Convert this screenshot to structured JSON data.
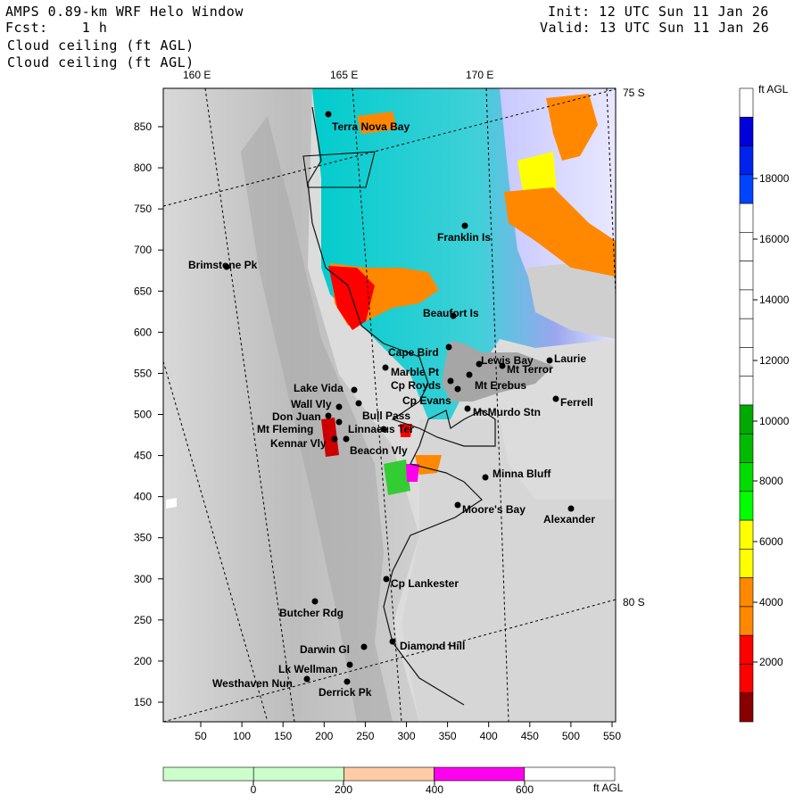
{
  "header": {
    "title": "AMPS 0.89-km WRF Helo Window",
    "fcst": "Fcst:    1 h",
    "field1": "Cloud ceiling (ft AGL)",
    "field2": "Cloud ceiling (ft AGL)",
    "init": "Init: 12 UTC Sun 11 Jan 26",
    "valid": "Valid: 13 UTC Sun 11 Jan 26"
  },
  "axes": {
    "lon_labels": [
      "160 E",
      "165 E",
      "170 E"
    ],
    "lat_labels": [
      "75 S",
      "80 S"
    ],
    "y_ticks": [
      "850",
      "800",
      "750",
      "700",
      "650",
      "600",
      "550",
      "500",
      "450",
      "400",
      "350",
      "300",
      "250",
      "200",
      "150"
    ],
    "x_ticks": [
      "50",
      "100",
      "150",
      "200",
      "250",
      "300",
      "350",
      "400",
      "450",
      "500",
      "550"
    ]
  },
  "colorbar_right": {
    "unit": "ft AGL",
    "labels": [
      "18000",
      "16000",
      "14000",
      "12000",
      "10000",
      "8000",
      "6000",
      "4000",
      "2000"
    ],
    "colors": [
      "#ffffff",
      "#0000dd",
      "#0022ee",
      "#0044ff",
      "#ffffff",
      "#ffffff",
      "#ffffff",
      "#ffffff",
      "#ffffff",
      "#ffffff",
      "#ffffff",
      "#00aa00",
      "#00bb00",
      "#00dd00",
      "#00ff00",
      "#ffff00",
      "#ffff00",
      "#ff8800",
      "#ff8800",
      "#ff0000",
      "#ff0000",
      "#880000"
    ]
  },
  "colorbar_bottom": {
    "unit": "ft AGL",
    "labels": [
      "0",
      "200",
      "400",
      "600"
    ],
    "colors": [
      "#ccffcc",
      "#ccffcc",
      "#ffcca6",
      "#ff00ee",
      "#ffffff"
    ]
  },
  "stations": [
    {
      "name": "Terra Nova Bay"
    },
    {
      "name": "Franklin Is"
    },
    {
      "name": "Brimstone Pk"
    },
    {
      "name": "Beaufort Is"
    },
    {
      "name": "Cape Bird"
    },
    {
      "name": "Lewis Bay"
    },
    {
      "name": "Laurie"
    },
    {
      "name": "Mt Terror"
    },
    {
      "name": "Marble Pt"
    },
    {
      "name": "Cp Royds"
    },
    {
      "name": "Mt Erebus"
    },
    {
      "name": "Lake Vida"
    },
    {
      "name": "Cp Evans"
    },
    {
      "name": "Ferrell"
    },
    {
      "name": "Wall Vly"
    },
    {
      "name": "Bull Pass"
    },
    {
      "name": "McMurdo Stn"
    },
    {
      "name": "Don Juan"
    },
    {
      "name": "Mt Fleming"
    },
    {
      "name": "Linnaeus Ter"
    },
    {
      "name": "Kennar Vly"
    },
    {
      "name": "Beacon Vly"
    },
    {
      "name": "Minna Bluff"
    },
    {
      "name": "Moore's Bay"
    },
    {
      "name": "Alexander"
    },
    {
      "name": "Cp Lankester"
    },
    {
      "name": "Butcher Rdg"
    },
    {
      "name": "Darwin Gl"
    },
    {
      "name": "Diamond Hill"
    },
    {
      "name": "Lk Wellman"
    },
    {
      "name": "Westhaven Nun"
    },
    {
      "name": "Derrick Pk"
    }
  ]
}
